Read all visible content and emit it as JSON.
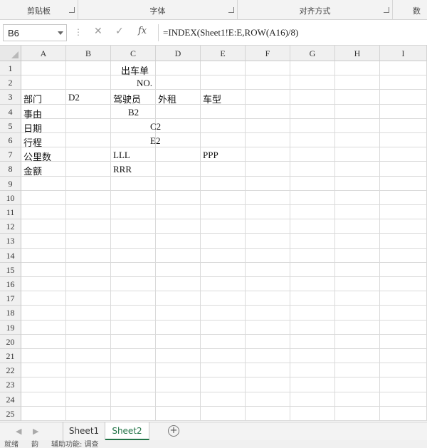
{
  "ribbon": {
    "groups": [
      {
        "label": "剪贴板"
      },
      {
        "label": "字体"
      },
      {
        "label": "对齐方式"
      },
      {
        "label": "数"
      }
    ]
  },
  "formula_bar": {
    "name_box": "B6",
    "formula": "=INDEX(Sheet1!E:E,ROW(A16)/8)"
  },
  "columns": [
    "A",
    "B",
    "C",
    "D",
    "E",
    "F",
    "G",
    "H",
    "I"
  ],
  "rows": [
    "1",
    "2",
    "3",
    "4",
    "5",
    "6",
    "7",
    "8",
    "9",
    "10",
    "11",
    "12",
    "13",
    "14",
    "15",
    "16",
    "17",
    "18",
    "19",
    "20",
    "21",
    "22",
    "23",
    "24",
    "25"
  ],
  "cells": {
    "r1_title": "出车单",
    "r2_no": "NO.",
    "r3_a": "部门",
    "r3_b": "D2",
    "r3_c": "驾驶员",
    "r3_d": "外租",
    "r3_e": "车型",
    "r4_a": "事由",
    "r4_c": "B2",
    "r5_a": "日期",
    "r5_d": "C2",
    "r6_a": "行程",
    "r6_d": "E2",
    "r7_a": "公里数",
    "r7_c": "LLL",
    "r7_e": "PPP",
    "r8_a": "金额",
    "r8_c": "RRR"
  },
  "sheet_tabs": {
    "tabs": [
      "Sheet1",
      "Sheet2"
    ],
    "active": "Sheet2"
  },
  "status_bar": {
    "ready": "就绪",
    "mode": "韵",
    "accessibility": "辅助功能: 调查"
  }
}
